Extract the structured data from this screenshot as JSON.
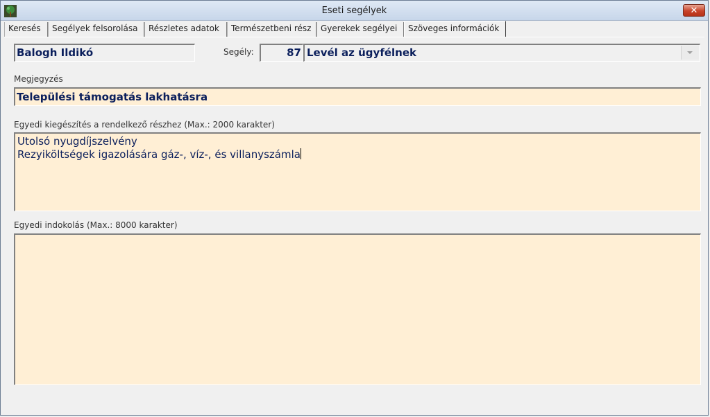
{
  "window": {
    "title": "Eseti segélyek",
    "close_label": "✕"
  },
  "tabs": [
    {
      "label": "Keresés"
    },
    {
      "label": "Segélyek felsorolása"
    },
    {
      "label": "Részletes adatok"
    },
    {
      "label": "Természetbeni rész"
    },
    {
      "label": "Gyerekek segélyei"
    },
    {
      "label": "Szöveges információk",
      "active": true
    }
  ],
  "header": {
    "name": "Balogh Ildikó",
    "segely_label": "Segély:",
    "segely_number": "87",
    "segely_type": "Levél az ügyfélnek"
  },
  "megjegyzes": {
    "label": "Megjegyzés",
    "value": "Települési támogatás lakhatásra"
  },
  "kiegeszites": {
    "label": "Egyedi kiegészítés a rendelkező részhez  (Max.: 2000 karakter)",
    "line1": "Utolsó nyugdíjszelvény",
    "line2": "Rezyiköltségek igazolására gáz-, víz-, és villanyszámla"
  },
  "indokolas": {
    "label": "Egyedi indokolás (Max.: 8000 karakter)",
    "value": ""
  },
  "colors": {
    "field_bg": "#ffefd5",
    "text_accent": "#0b1f5c",
    "close_red": "#c8432b"
  }
}
